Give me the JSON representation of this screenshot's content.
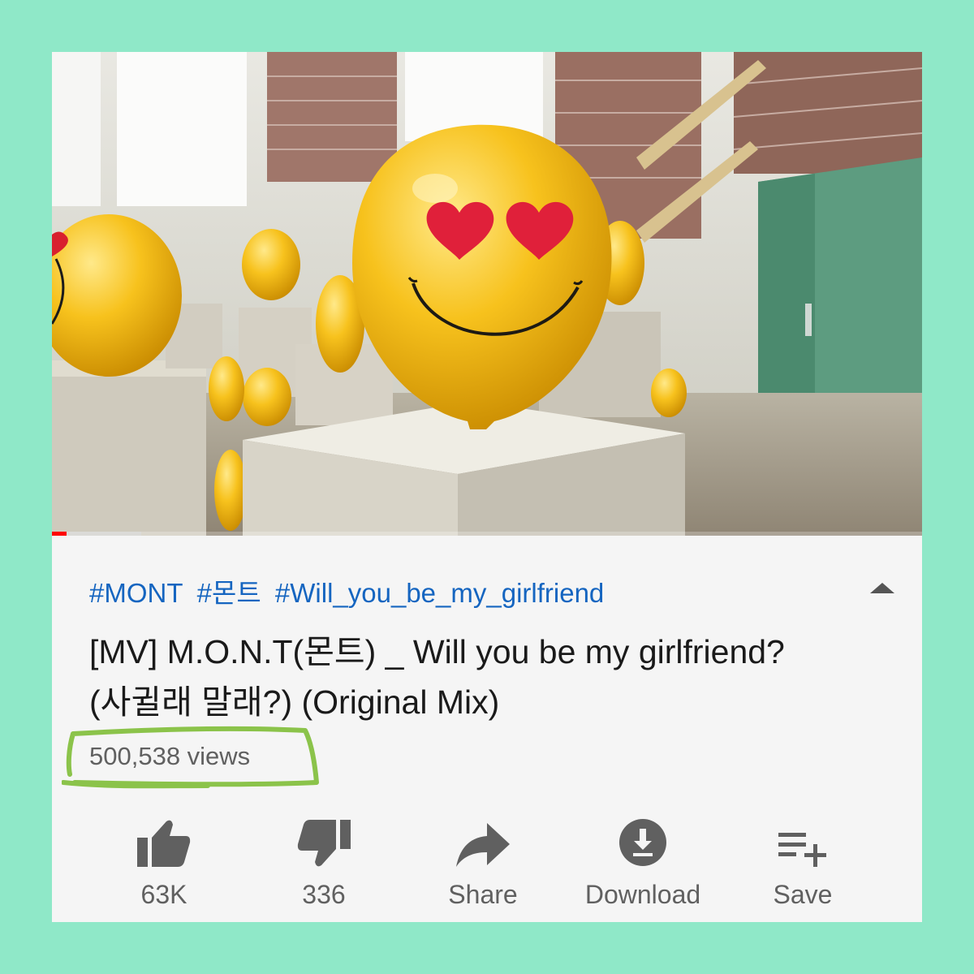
{
  "video": {
    "progress_fraction": 0.017,
    "buffered_fraction": 0.103
  },
  "hashtags": [
    "#MONT",
    "#몬트",
    "#Will_you_be_my_girlfriend"
  ],
  "title_line1": "[MV] M.O.N.T(몬트) _ Will you be my girlfriend?",
  "title_line2": "(사귈래 말래?) (Original Mix)",
  "views": "500,538 views",
  "actions": [
    {
      "icon": "thumbs-up-icon",
      "label": "63K"
    },
    {
      "icon": "thumbs-down-icon",
      "label": "336"
    },
    {
      "icon": "share-icon",
      "label": "Share"
    },
    {
      "icon": "download-icon",
      "label": "Download"
    },
    {
      "icon": "save-playlist-icon",
      "label": "Save"
    }
  ],
  "colors": {
    "background": "#8fe8c8",
    "hashtag": "#1565c0",
    "highlight_marker": "#8bc34a",
    "progress": "#ff0000"
  }
}
